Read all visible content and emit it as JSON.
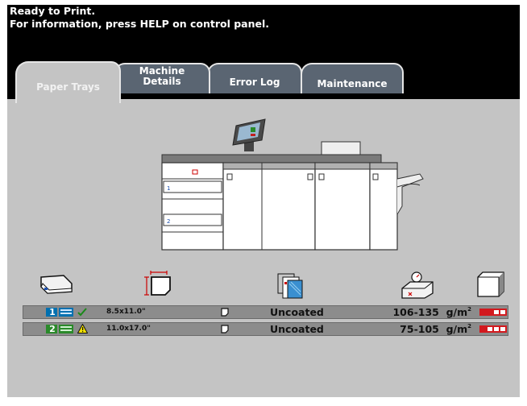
{
  "status": {
    "line1": "Ready to Print.",
    "line2": "For information, press HELP on control panel."
  },
  "tabs": [
    {
      "label": "Paper Trays",
      "active": true
    },
    {
      "label_line1": "Machine",
      "label_line2": "Details",
      "active": false
    },
    {
      "label": "Error Log",
      "active": false
    },
    {
      "label": "Maintenance",
      "active": false
    }
  ],
  "colors": {
    "panel": "#c4c4c4",
    "tab_inactive": "#5a6572",
    "row_bg": "#8c8c8c",
    "tray1_number_bg": "#0070b0",
    "tray2_number_bg": "#2a8a2a",
    "fill_gauge": "#d2191e",
    "ok_check": "#1a8a1a",
    "warning": "#f0e000"
  },
  "column_icons": [
    "tray-icon",
    "paper-size-icon",
    "paper-type-icon",
    "paper-weight-icon",
    "paper-level-icon"
  ],
  "trays": [
    {
      "number": "1",
      "status_icon": "check-icon",
      "size": "8.5x11.0\"",
      "type": "Uncoated",
      "weight": "106-135",
      "weight_unit": "g/m",
      "weight_exp": "2",
      "level_fraction": 0.5
    },
    {
      "number": "2",
      "status_icon": "warning-icon",
      "size": "11.0x17.0\"",
      "type": "Uncoated",
      "weight": "75-105",
      "weight_unit": "g/m",
      "weight_exp": "2",
      "level_fraction": 0.25
    }
  ]
}
